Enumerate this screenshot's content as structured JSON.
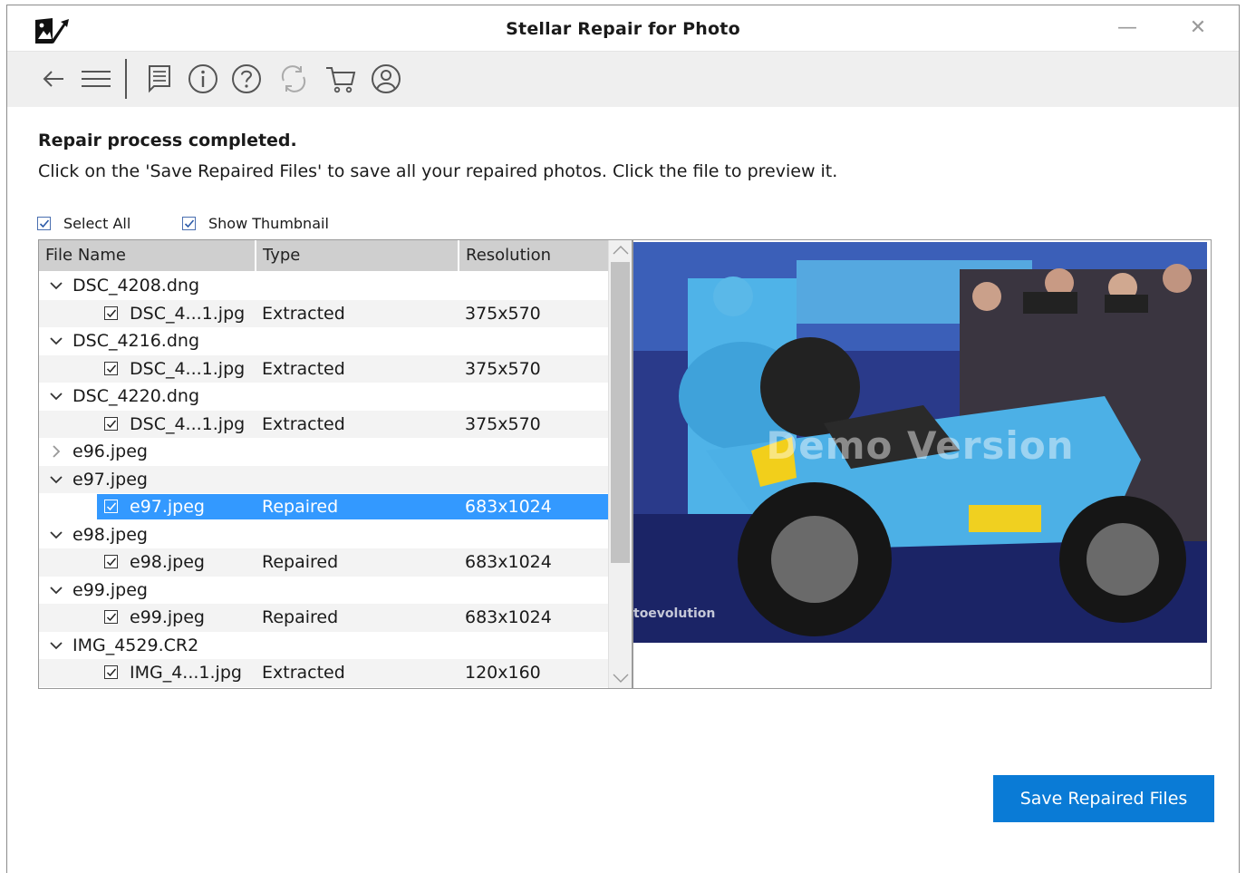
{
  "window": {
    "title": "Stellar Repair for Photo",
    "minimize_glyph": "—",
    "close_glyph": "✕"
  },
  "toolbar": {
    "icons": [
      "back-arrow-icon",
      "menu-icon",
      "report-icon",
      "info-icon",
      "help-icon",
      "refresh-icon",
      "cart-icon",
      "account-icon"
    ]
  },
  "status": {
    "heading": "Repair process completed.",
    "message": "Click on the 'Save Repaired Files' to save all your repaired photos. Click the file to preview it."
  },
  "options": {
    "select_all": "Select All",
    "show_thumbnail": "Show Thumbnail"
  },
  "file_list": {
    "columns": [
      "File Name",
      "Type",
      "Resolution"
    ],
    "rows": [
      {
        "kind": "parent",
        "name": "DSC_4208.dng",
        "expanded": true
      },
      {
        "kind": "child",
        "name": "DSC_4...1.jpg",
        "type": "Extracted",
        "resolution": "375x570"
      },
      {
        "kind": "parent",
        "name": "DSC_4216.dng",
        "expanded": true
      },
      {
        "kind": "child",
        "name": "DSC_4...1.jpg",
        "type": "Extracted",
        "resolution": "375x570"
      },
      {
        "kind": "parent",
        "name": "DSC_4220.dng",
        "expanded": true
      },
      {
        "kind": "child",
        "name": "DSC_4...1.jpg",
        "type": "Extracted",
        "resolution": "375x570"
      },
      {
        "kind": "parent",
        "name": "e96.jpeg",
        "expanded": false
      },
      {
        "kind": "parent",
        "name": "e97.jpeg",
        "expanded": true
      },
      {
        "kind": "child",
        "name": "e97.jpeg",
        "type": "Repaired",
        "resolution": "683x1024",
        "selected": true
      },
      {
        "kind": "parent",
        "name": "e98.jpeg",
        "expanded": true
      },
      {
        "kind": "child",
        "name": "e98.jpeg",
        "type": "Repaired",
        "resolution": "683x1024"
      },
      {
        "kind": "parent",
        "name": "e99.jpeg",
        "expanded": true
      },
      {
        "kind": "child",
        "name": "e99.jpeg",
        "type": "Repaired",
        "resolution": "683x1024"
      },
      {
        "kind": "parent",
        "name": "IMG_4529.CR2",
        "expanded": true
      },
      {
        "kind": "child",
        "name": "IMG_4...1.jpg",
        "type": "Extracted",
        "resolution": "120x160"
      }
    ]
  },
  "preview": {
    "overlay_text": "Demo Version",
    "watermark": "toevolution"
  },
  "actions": {
    "save_label": "Save Repaired Files"
  },
  "colors": {
    "accent": "#0a7bd6",
    "selection": "#3399ff",
    "header_bg": "#cfcfcf",
    "toolbar_bg": "#efefef"
  }
}
